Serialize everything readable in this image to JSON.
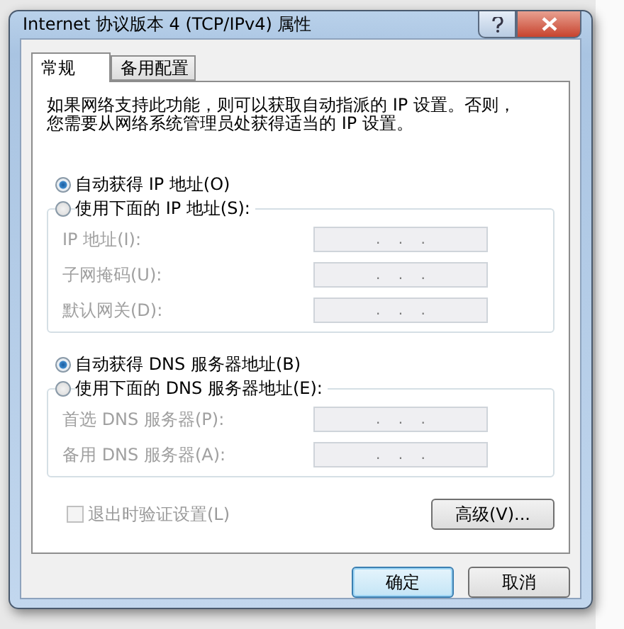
{
  "window": {
    "title": "Internet 协议版本 4 (TCP/IPv4) 属性"
  },
  "tabs": [
    {
      "label": "常规",
      "selected": true
    },
    {
      "label": "备用配置",
      "selected": false
    }
  ],
  "description": "如果网络支持此功能，则可以获取自动指派的 IP 设置。否则，您需要从网络系统管理员处获得适当的 IP 设置。",
  "groups": [
    {
      "auto_option": {
        "label": "自动获得 IP 地址(O)",
        "selected": true
      },
      "manual_option": {
        "label": "使用下面的 IP 地址(S):",
        "selected": false
      },
      "fields": [
        {
          "label": "IP 地址(I):",
          "value": ".    .    .",
          "disabled": true
        },
        {
          "label": "子网掩码(U):",
          "value": ".    .    .",
          "disabled": true
        },
        {
          "label": "默认网关(D):",
          "value": ".    .    .",
          "disabled": true
        }
      ]
    },
    {
      "auto_option": {
        "label": "自动获得 DNS 服务器地址(B)",
        "selected": true
      },
      "manual_option": {
        "label": "使用下面的 DNS 服务器地址(E):",
        "selected": false
      },
      "fields": [
        {
          "label": "首选 DNS 服务器(P):",
          "value": ".    .    .",
          "disabled": true
        },
        {
          "label": "备用 DNS 服务器(A):",
          "value": ".    .    .",
          "disabled": true
        }
      ]
    }
  ],
  "validate_checkbox": {
    "label": "退出时验证设置(L)",
    "checked": false,
    "disabled": true
  },
  "advanced_button": "高级(V)...",
  "buttons": [
    {
      "label": "确定",
      "default": true
    },
    {
      "label": "取消",
      "default": false
    }
  ]
}
